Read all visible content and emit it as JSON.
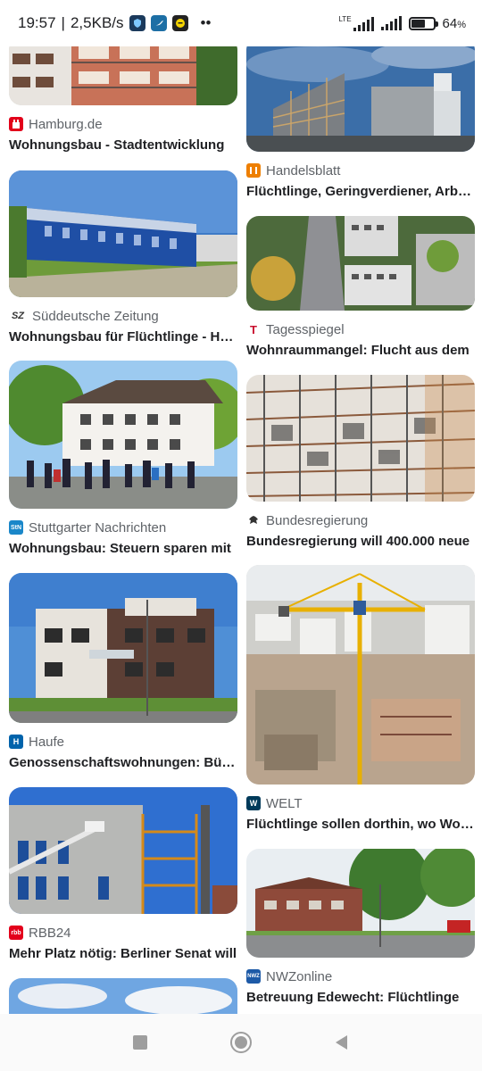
{
  "status_bar": {
    "time": "19:57",
    "speed": "2,5KB/s",
    "network": "LTE",
    "battery": "64",
    "battery_unit": "%",
    "battery_level": 0.64,
    "dots": "••",
    "icons": [
      "shield-app-icon",
      "bird-app-icon",
      "smiley-app-icon"
    ]
  },
  "results": {
    "left": [
      {
        "source": "Hamburg.de",
        "title": "Wohnungsbau - Stadtentwicklung",
        "source_color": "#e2001a"
      },
      {
        "source": "Süddeutsche Zeitung",
        "title": "Wohnungsbau für Flüchtlinge - Hamburg",
        "source_color": "#555555"
      },
      {
        "source": "Stuttgarter Nachrichten",
        "title": "Wohnungsbau: Steuern sparen mit",
        "source_color": "#1a87c9"
      },
      {
        "source": "Haufe",
        "title": "Genossenschaftswohnungen: Bürger",
        "source_color": "#0063ab"
      },
      {
        "source": "RBB24",
        "title": "Mehr Platz nötig: Berliner Senat will",
        "source_color": "#e3001b"
      }
    ],
    "right": [
      {
        "source": "Handelsblatt",
        "title": "Flüchtlinge, Geringverdiener, Arbeitslose",
        "source_color": "#ee7f00"
      },
      {
        "source": "Tagesspiegel",
        "title": "Wohnraummangel: Flucht aus dem",
        "source_color": "#c8102e"
      },
      {
        "source": "Bundesregierung",
        "title": "Bundesregierung will 400.000 neue",
        "source_color": "#333333"
      },
      {
        "source": "WELT",
        "title": "Flüchtlinge sollen dorthin, wo Wohnungen",
        "source_color": "#003a5a"
      },
      {
        "source": "NWZonline",
        "title": "Betreuung Edewecht: Flüchtlinge",
        "source_color": "#1d5aa7"
      }
    ]
  },
  "nav": {
    "recents": "square-icon",
    "home": "circle-icon",
    "back": "triangle-icon"
  }
}
